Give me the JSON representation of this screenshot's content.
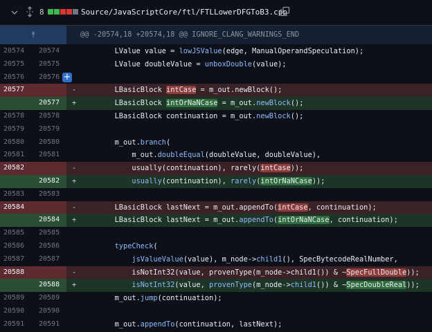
{
  "file": {
    "changes_count": "8",
    "diffstat": [
      "#3fb950",
      "#3fb950",
      "#da3633",
      "#da3633",
      "#6e7681"
    ],
    "path": "Source/JavaScriptCore/ftl/FTLLowerDFGToB3.cpp"
  },
  "hunk": {
    "header": "@@ -20574,18 +20574,18 @@ IGNORE_CLANG_WARNINGS_END"
  },
  "lines": [
    {
      "type": "ctx",
      "old": "20574",
      "new": "20574",
      "code": [
        [
          "        LValue value = ",
          ""
        ],
        [
          "lowJSValue",
          "f"
        ],
        [
          "(edge, ManualOperandSpeculation);",
          ""
        ]
      ]
    },
    {
      "type": "ctx",
      "old": "20575",
      "new": "20575",
      "code": [
        [
          "        LValue doubleValue = ",
          ""
        ],
        [
          "unboxDouble",
          "f"
        ],
        [
          "(value);",
          ""
        ]
      ]
    },
    {
      "type": "ctx",
      "old": "20576",
      "new": "20576",
      "code": [],
      "add_comment_button": "+"
    },
    {
      "type": "del",
      "old": "20577",
      "new": "",
      "sign": "-",
      "code": [
        [
          "        LBasicBlock ",
          ""
        ],
        [
          "intCase",
          "hd"
        ],
        [
          " = m_out.newBlock();",
          ""
        ]
      ]
    },
    {
      "type": "add",
      "old": "",
      "new": "20577",
      "sign": "+",
      "code": [
        [
          "        LBasicBlock ",
          ""
        ],
        [
          "intOrNaNCase",
          "ha"
        ],
        [
          " = m_out.",
          ""
        ],
        [
          "newBlock",
          "f"
        ],
        [
          "();",
          ""
        ]
      ]
    },
    {
      "type": "ctx",
      "old": "20578",
      "new": "20578",
      "code": [
        [
          "        LBasicBlock continuation = m_out.",
          ""
        ],
        [
          "newBlock",
          "f"
        ],
        [
          "();",
          ""
        ]
      ]
    },
    {
      "type": "ctx",
      "old": "20579",
      "new": "20579",
      "code": []
    },
    {
      "type": "ctx",
      "old": "20580",
      "new": "20580",
      "code": [
        [
          "        m_out.",
          ""
        ],
        [
          "branch",
          "f"
        ],
        [
          "(",
          ""
        ]
      ]
    },
    {
      "type": "ctx",
      "old": "20581",
      "new": "20581",
      "code": [
        [
          "            m_out.",
          ""
        ],
        [
          "doubleEqual",
          "f"
        ],
        [
          "(doubleValue, doubleValue),",
          ""
        ]
      ]
    },
    {
      "type": "del",
      "old": "20582",
      "new": "",
      "sign": "-",
      "code": [
        [
          "            usually(continuation), rarely(",
          ""
        ],
        [
          "intCase",
          "hd"
        ],
        [
          "));",
          ""
        ]
      ]
    },
    {
      "type": "add",
      "old": "",
      "new": "20582",
      "sign": "+",
      "code": [
        [
          "            ",
          ""
        ],
        [
          "usually",
          "f"
        ],
        [
          "(continuation), ",
          ""
        ],
        [
          "rarely",
          "f"
        ],
        [
          "(",
          ""
        ],
        [
          "intOrNaNCase",
          "ha"
        ],
        [
          "));",
          ""
        ]
      ]
    },
    {
      "type": "ctx",
      "old": "20583",
      "new": "20583",
      "code": []
    },
    {
      "type": "del",
      "old": "20584",
      "new": "",
      "sign": "-",
      "code": [
        [
          "        LBasicBlock lastNext = m_out.appendTo(",
          ""
        ],
        [
          "intCase",
          "hd"
        ],
        [
          ", continuation);",
          ""
        ]
      ]
    },
    {
      "type": "add",
      "old": "",
      "new": "20584",
      "sign": "+",
      "code": [
        [
          "        LBasicBlock lastNext = m_out.",
          ""
        ],
        [
          "appendTo",
          "f"
        ],
        [
          "(",
          ""
        ],
        [
          "intOrNaNCase",
          "ha"
        ],
        [
          ", continuation);",
          ""
        ]
      ]
    },
    {
      "type": "ctx",
      "old": "20585",
      "new": "20585",
      "code": []
    },
    {
      "type": "ctx",
      "old": "20586",
      "new": "20586",
      "code": [
        [
          "        ",
          ""
        ],
        [
          "typeCheck",
          "f"
        ],
        [
          "(",
          ""
        ]
      ]
    },
    {
      "type": "ctx",
      "old": "20587",
      "new": "20587",
      "code": [
        [
          "            ",
          ""
        ],
        [
          "jsValueValue",
          "f"
        ],
        [
          "(value), m_node->",
          ""
        ],
        [
          "child1",
          "f"
        ],
        [
          "(), SpecBytecodeRealNumber,",
          ""
        ]
      ]
    },
    {
      "type": "del",
      "old": "20588",
      "new": "",
      "sign": "-",
      "code": [
        [
          "            isNotInt32(value, provenType(m_node->child1()) & ~",
          ""
        ],
        [
          "SpecFullDouble",
          "hd"
        ],
        [
          "));",
          ""
        ]
      ]
    },
    {
      "type": "add",
      "old": "",
      "new": "20588",
      "sign": "+",
      "code": [
        [
          "            ",
          ""
        ],
        [
          "isNotInt32",
          "f"
        ],
        [
          "(value, ",
          ""
        ],
        [
          "provenType",
          "f"
        ],
        [
          "(m_node->",
          ""
        ],
        [
          "child1",
          "f"
        ],
        [
          "()) & ~",
          ""
        ],
        [
          "SpecDoubleReal",
          "ha"
        ],
        [
          "));",
          ""
        ]
      ]
    },
    {
      "type": "ctx",
      "old": "20589",
      "new": "20589",
      "code": [
        [
          "        m_out.",
          ""
        ],
        [
          "jump",
          "f"
        ],
        [
          "(continuation);",
          ""
        ]
      ]
    },
    {
      "type": "ctx",
      "old": "20590",
      "new": "20590",
      "code": []
    },
    {
      "type": "ctx",
      "old": "20591",
      "new": "20591",
      "code": [
        [
          "        m_out.",
          ""
        ],
        [
          "appendTo",
          "f"
        ],
        [
          "(continuation, lastNext);",
          ""
        ]
      ]
    }
  ]
}
